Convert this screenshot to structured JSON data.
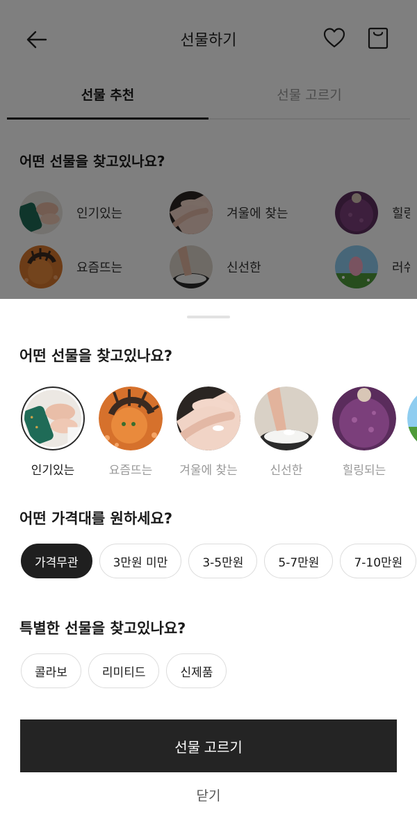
{
  "background": {
    "title": "선물하기",
    "icons": [
      "back-arrow-icon",
      "heart-icon",
      "shopping-bag-icon"
    ],
    "tabs": [
      {
        "label": "선물 추천",
        "active": true
      },
      {
        "label": "선물 고르기",
        "active": false
      }
    ],
    "question": "어떤 선물을 찾고있나요?",
    "categories": [
      {
        "label": "인기있는"
      },
      {
        "label": "겨울에 찾는"
      },
      {
        "label": "힐링"
      },
      {
        "label": "요즘뜨는"
      },
      {
        "label": "신선한"
      },
      {
        "label": "러쉬"
      }
    ]
  },
  "sheet": {
    "category_question": "어떤 선물을 찾고있나요?",
    "categories": [
      {
        "label": "인기있는",
        "selected": true
      },
      {
        "label": "요즘뜨는",
        "selected": false
      },
      {
        "label": "겨울에 찾는",
        "selected": false
      },
      {
        "label": "신선한",
        "selected": false
      },
      {
        "label": "힐링되는",
        "selected": false
      }
    ],
    "price_question": "어떤 가격대를 원하세요?",
    "price_ranges": [
      {
        "label": "가격무관",
        "selected": true
      },
      {
        "label": "3만원 미만",
        "selected": false
      },
      {
        "label": "3-5만원",
        "selected": false
      },
      {
        "label": "5-7만원",
        "selected": false
      },
      {
        "label": "7-10만원",
        "selected": false
      }
    ],
    "special_question": "특별한 선물을 찾고있나요?",
    "special_tags": [
      {
        "label": "콜라보"
      },
      {
        "label": "리미티드"
      },
      {
        "label": "신제품"
      }
    ],
    "submit_label": "선물 고르기",
    "close_label": "닫기"
  },
  "colors": {
    "primary_button": "#242424",
    "selected_chip": "#1f1f1f",
    "overlay": "rgba(0,0,0,0.5)"
  }
}
